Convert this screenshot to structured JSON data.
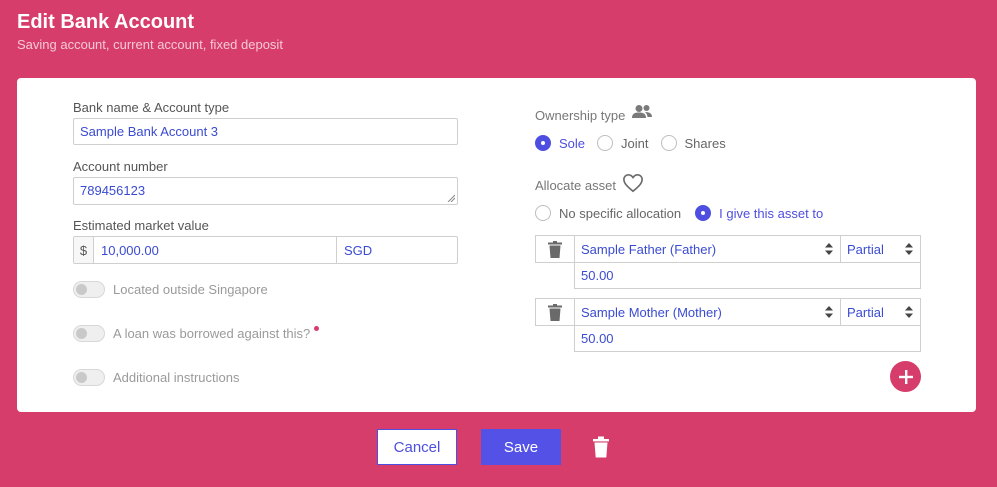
{
  "header": {
    "title": "Edit Bank Account",
    "subtitle": "Saving account, current account, fixed deposit"
  },
  "form": {
    "bank_name": {
      "label": "Bank name & Account type",
      "value": "Sample Bank Account 3"
    },
    "account_number": {
      "label": "Account number",
      "value": "789456123"
    },
    "market_value": {
      "label": "Estimated market value",
      "prefix": "$",
      "value": "10,000.00",
      "currency": "SGD"
    },
    "toggles": [
      {
        "label": "Located outside Singapore",
        "on": false
      },
      {
        "label": "A loan was borrowed against this?",
        "on": false
      },
      {
        "label": "Additional instructions",
        "on": false
      }
    ]
  },
  "ownership": {
    "label": "Ownership type",
    "options": [
      "Sole",
      "Joint",
      "Shares"
    ],
    "selected": "Sole"
  },
  "allocation": {
    "label": "Allocate asset",
    "options": [
      "No specific allocation",
      "I give this asset to"
    ],
    "selected": "I give this asset to",
    "beneficiaries": [
      {
        "person": "Sample Father (Father)",
        "share_type": "Partial",
        "amount": "50.00"
      },
      {
        "person": "Sample Mother (Mother)",
        "share_type": "Partial",
        "amount": "50.00"
      }
    ]
  },
  "footer": {
    "cancel_label": "Cancel",
    "save_label": "Save"
  },
  "colors": {
    "brand": "#d63d6b",
    "accent": "#4e4ee0",
    "value_text": "#3a4bd1"
  }
}
